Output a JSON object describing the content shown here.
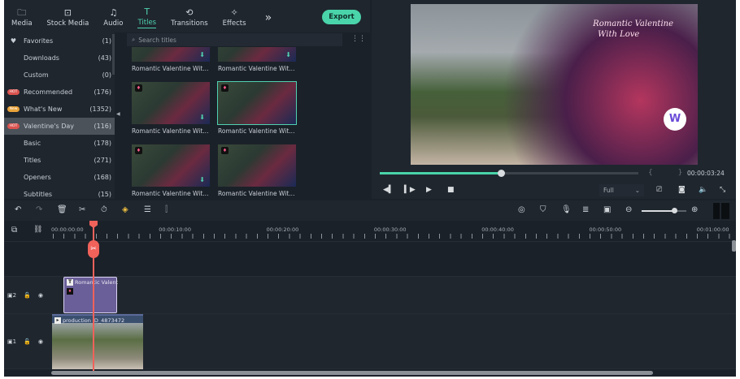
{
  "toolbar": {
    "tabs": [
      {
        "label": "Media",
        "icon": "folder-icon"
      },
      {
        "label": "Stock Media",
        "icon": "stock-icon"
      },
      {
        "label": "Audio",
        "icon": "music-icon"
      },
      {
        "label": "Titles",
        "icon": "text-icon",
        "active": true
      },
      {
        "label": "Transitions",
        "icon": "transitions-icon"
      },
      {
        "label": "Effects",
        "icon": "effects-icon"
      }
    ],
    "more": "»",
    "export": "Export"
  },
  "sidebar": {
    "items": [
      {
        "label": "Favorites",
        "count": "(1)",
        "icon": "heart"
      },
      {
        "label": "Downloads",
        "count": "(43)"
      },
      {
        "label": "Custom",
        "count": "(0)"
      },
      {
        "label": "Recommended",
        "count": "(176)",
        "badge": "HOT"
      },
      {
        "label": "What's New",
        "count": "(1352)",
        "badge": "New"
      },
      {
        "label": "Valentine's Day",
        "count": "(116)",
        "badge": "HOT",
        "active": true
      },
      {
        "label": "Basic",
        "count": "(178)"
      },
      {
        "label": "Titles",
        "count": "(271)"
      },
      {
        "label": "Openers",
        "count": "(168)"
      },
      {
        "label": "Subtitles",
        "count": "(15)"
      }
    ]
  },
  "search": {
    "placeholder": "Search titles"
  },
  "titles": [
    "Romantic Valentine Wit...",
    "Romantic Valentine Wit...",
    "Romantic Valentine Wit...",
    "Romantic Valentine Wit...",
    "Romantic Valentine Wit...",
    "Romantic Valentine Wit..."
  ],
  "preview": {
    "overlay_line1": "Romantic Valentine",
    "overlay_line2": "With Love",
    "timecode": "00:00:03:24",
    "progress": 0.47,
    "quality": "Full",
    "brackets": "{ }"
  },
  "colors": {
    "accent": "#4ad4a9",
    "playhead": "#f0625a",
    "title_clip": "#6a5f98"
  },
  "timeline": {
    "ruler": [
      "00:00:00:00",
      "00:00:10:00",
      "00:00:20:00",
      "00:00:30:00",
      "00:00:40:00",
      "00:00:50:00",
      "00:01:00:00"
    ],
    "zoom": 0.72,
    "tracks": [
      {
        "num": "2",
        "clip": "Romantic Valent"
      },
      {
        "num": "1",
        "clip": "production ID_4873472"
      }
    ]
  }
}
